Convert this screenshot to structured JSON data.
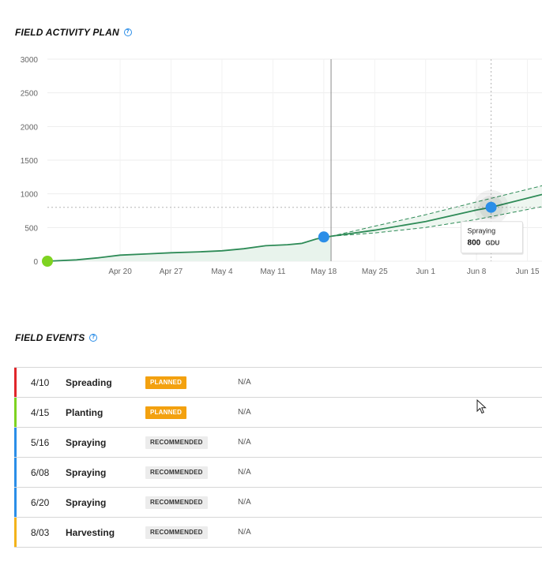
{
  "plan": {
    "title": "FIELD ACTIVITY PLAN",
    "help_icon": "help-circle-icon"
  },
  "events_section": {
    "title": "FIELD EVENTS",
    "help_icon": "help-circle-icon"
  },
  "chart_data": {
    "type": "line",
    "title": "",
    "xlabel": "",
    "ylabel": "",
    "ylim": [
      0,
      3000
    ],
    "yticks": [
      0,
      500,
      1000,
      1500,
      2000,
      2500,
      3000
    ],
    "xlim": [
      "2021-04-10",
      "2021-06-17"
    ],
    "xticks": [
      {
        "date": "2021-04-20",
        "label": "Apr 20"
      },
      {
        "date": "2021-04-27",
        "label": "Apr 27"
      },
      {
        "date": "2021-05-04",
        "label": "May 4"
      },
      {
        "date": "2021-05-11",
        "label": "May 11"
      },
      {
        "date": "2021-05-18",
        "label": "May 18"
      },
      {
        "date": "2021-05-25",
        "label": "May 25"
      },
      {
        "date": "2021-06-01",
        "label": "Jun 1"
      },
      {
        "date": "2021-06-08",
        "label": "Jun 8"
      },
      {
        "date": "2021-06-15",
        "label": "Jun 15"
      }
    ],
    "grid": true,
    "today": "2021-05-19",
    "series": [
      {
        "role": "actual",
        "color": "#2e8b57",
        "points": [
          {
            "x": "2021-04-10",
            "y": 0
          },
          {
            "x": "2021-04-14",
            "y": 20
          },
          {
            "x": "2021-04-17",
            "y": 50
          },
          {
            "x": "2021-04-20",
            "y": 90
          },
          {
            "x": "2021-04-24",
            "y": 110
          },
          {
            "x": "2021-04-27",
            "y": 125
          },
          {
            "x": "2021-05-01",
            "y": 140
          },
          {
            "x": "2021-05-04",
            "y": 155
          },
          {
            "x": "2021-05-07",
            "y": 185
          },
          {
            "x": "2021-05-10",
            "y": 230
          },
          {
            "x": "2021-05-13",
            "y": 245
          },
          {
            "x": "2021-05-15",
            "y": 265
          },
          {
            "x": "2021-05-17",
            "y": 330
          },
          {
            "x": "2021-05-19",
            "y": 370
          }
        ]
      },
      {
        "role": "forecast",
        "color": "#2e8b57",
        "points": [
          {
            "x": "2021-05-19",
            "y": 370
          },
          {
            "x": "2021-05-25",
            "y": 460
          },
          {
            "x": "2021-06-01",
            "y": 590
          },
          {
            "x": "2021-06-08",
            "y": 760
          },
          {
            "x": "2021-06-10",
            "y": 800
          },
          {
            "x": "2021-06-17",
            "y": 990
          }
        ]
      },
      {
        "role": "forecast-upper",
        "color": "#2e8b57",
        "points": [
          {
            "x": "2021-05-19",
            "y": 370
          },
          {
            "x": "2021-05-25",
            "y": 520
          },
          {
            "x": "2021-06-01",
            "y": 690
          },
          {
            "x": "2021-06-08",
            "y": 880
          },
          {
            "x": "2021-06-17",
            "y": 1120
          }
        ]
      },
      {
        "role": "forecast-lower",
        "color": "#2e8b57",
        "points": [
          {
            "x": "2021-05-19",
            "y": 370
          },
          {
            "x": "2021-05-25",
            "y": 420
          },
          {
            "x": "2021-06-01",
            "y": 500
          },
          {
            "x": "2021-06-08",
            "y": 620
          },
          {
            "x": "2021-06-17",
            "y": 810
          }
        ]
      }
    ],
    "markers": [
      {
        "x": "2021-04-10",
        "y": 0,
        "color": "#7ed321"
      },
      {
        "x": "2021-05-18",
        "y": 360,
        "color": "#2b8ee8"
      },
      {
        "x": "2021-06-10",
        "y": 800,
        "color": "#2b8ee8",
        "highlight": true
      }
    ],
    "tooltip": {
      "x": "2021-06-10",
      "y": 800,
      "label": "Spraying",
      "value": "800",
      "unit": "GDU"
    }
  },
  "events": [
    {
      "date": "4/10",
      "name": "Spreading",
      "status": "PLANNED",
      "status_type": "planned",
      "info": "N/A",
      "color": "#e0262b"
    },
    {
      "date": "4/15",
      "name": "Planting",
      "status": "PLANNED",
      "status_type": "planned",
      "info": "N/A",
      "color": "#7ed321"
    },
    {
      "date": "5/16",
      "name": "Spraying",
      "status": "RECOMMENDED",
      "status_type": "recommended",
      "info": "N/A",
      "color": "#2b8ee8"
    },
    {
      "date": "6/08",
      "name": "Spraying",
      "status": "RECOMMENDED",
      "status_type": "recommended",
      "info": "N/A",
      "color": "#2b8ee8"
    },
    {
      "date": "6/20",
      "name": "Spraying",
      "status": "RECOMMENDED",
      "status_type": "recommended",
      "info": "N/A",
      "color": "#2b8ee8"
    },
    {
      "date": "8/03",
      "name": "Harvesting",
      "status": "RECOMMENDED",
      "status_type": "recommended",
      "info": "N/A",
      "color": "#f3b31b"
    }
  ]
}
